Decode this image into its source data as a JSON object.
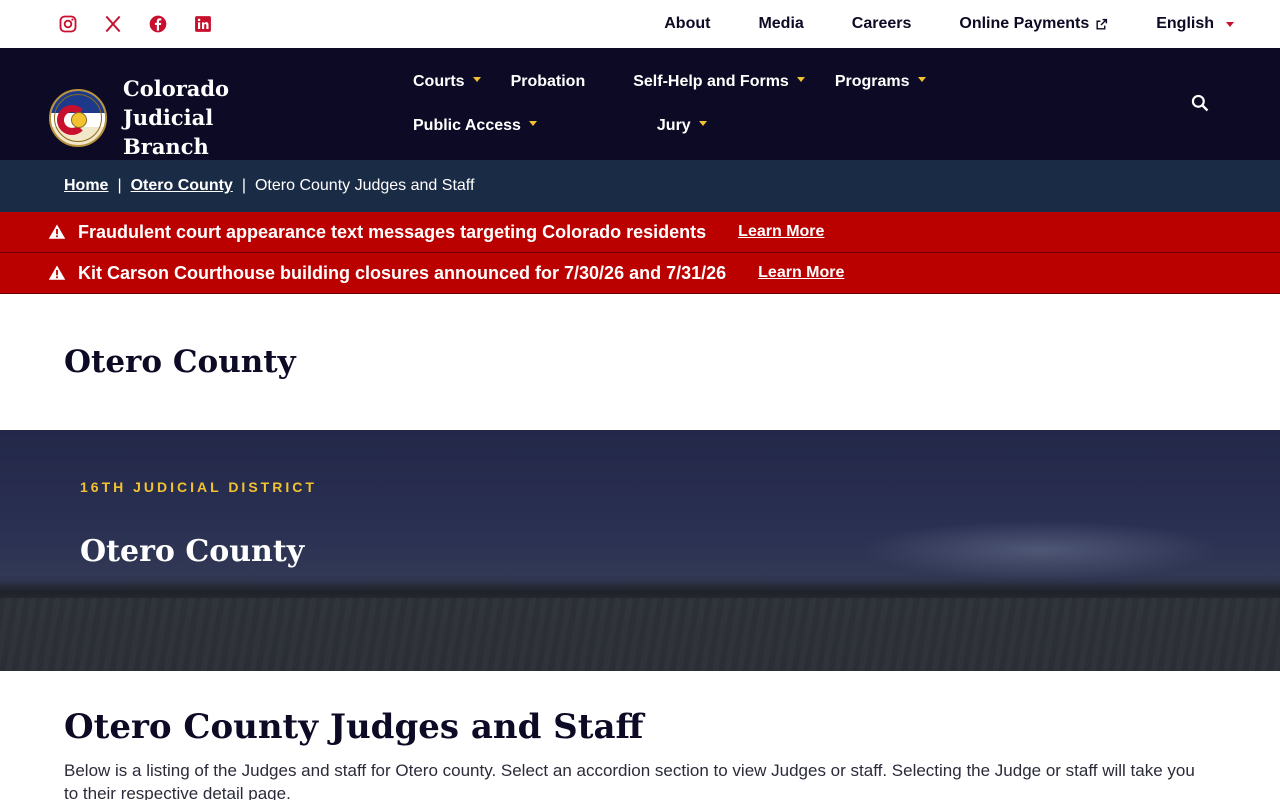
{
  "utility": {
    "social": [
      {
        "name": "instagram-icon"
      },
      {
        "name": "x-icon"
      },
      {
        "name": "facebook-icon"
      },
      {
        "name": "linkedin-icon"
      }
    ],
    "links": {
      "about": "About",
      "media": "Media",
      "careers": "Careers",
      "payments": "Online Payments",
      "language": "English"
    }
  },
  "brand": {
    "name_line1": "Colorado Judicial",
    "name_line2": "Branch"
  },
  "nav": {
    "courts": "Courts",
    "probation": "Probation",
    "self_help": "Self-Help and Forms",
    "programs": "Programs",
    "public_access": "Public Access",
    "jury": "Jury"
  },
  "breadcrumb": {
    "home": "Home",
    "county": "Otero County",
    "current": "Otero County Judges and Staff",
    "separator": "|"
  },
  "alerts": [
    {
      "message": "Fraudulent court appearance text messages targeting Colorado residents",
      "link": "Learn More"
    },
    {
      "message": "Kit Carson Courthouse building closures announced for 7/30/26 and 7/31/26",
      "link": "Learn More"
    }
  ],
  "county_heading": "Otero County",
  "hero": {
    "eyebrow": "16TH JUDICIAL DISTRICT",
    "title": "Otero County"
  },
  "content": {
    "heading": "Otero County Judges and Staff",
    "intro": "Below is a listing of the Judges and staff for Otero county. Select an accordion section to view Judges or staff. Selecting the Judge or staff will take you to their respective detail page."
  },
  "colors": {
    "navy": "#0c0a24",
    "breadcrumb_bg": "#1a2b45",
    "alert_red": "#bb0000",
    "accent_red": "#c8102e",
    "gold": "#f2c230"
  }
}
